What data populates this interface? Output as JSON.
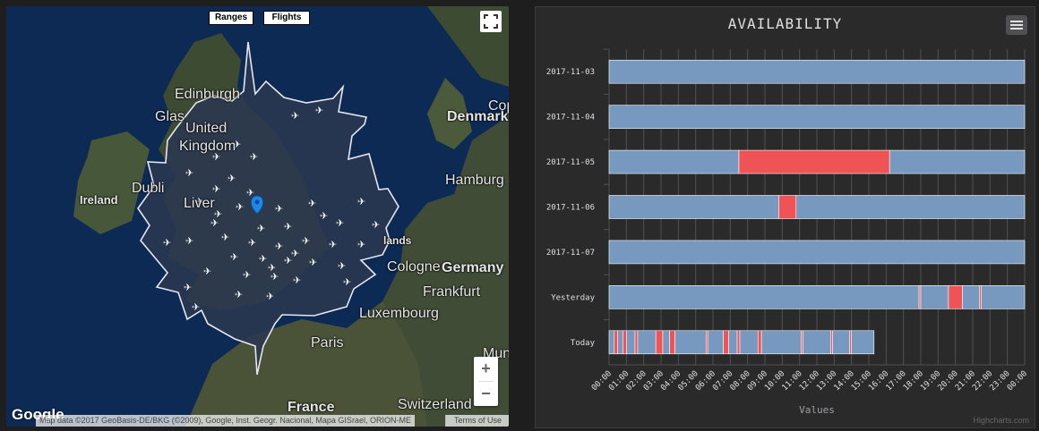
{
  "map": {
    "buttons": {
      "ranges": "Ranges",
      "flights": "Flights"
    },
    "labels": [
      {
        "name": "label-edinburgh",
        "text": "Edinburgh",
        "size": 11
      },
      {
        "name": "label-glasgow",
        "text": "Glas",
        "size": 11
      },
      {
        "name": "label-united",
        "text": "United",
        "size": 16
      },
      {
        "name": "label-kingdom",
        "text": "Kingdom",
        "size": 16
      },
      {
        "name": "label-denmark",
        "text": "Denmark",
        "size": 11
      },
      {
        "name": "label-cop",
        "text": "Cop",
        "size": 11
      },
      {
        "name": "label-ireland",
        "text": "Ireland",
        "size": 13
      },
      {
        "name": "label-dublin",
        "text": "Dubli",
        "size": 11
      },
      {
        "name": "label-hamburg",
        "text": "Hamburg",
        "size": 11
      },
      {
        "name": "label-liverpool",
        "text": "Liver",
        "size": 11
      },
      {
        "name": "label-lands",
        "text": "lands",
        "size": 12
      },
      {
        "name": "label-germany",
        "text": "Germany",
        "size": 16
      },
      {
        "name": "label-cologne",
        "text": "Cologne",
        "size": 11
      },
      {
        "name": "label-frankfurt",
        "text": "Frankfurt",
        "size": 11
      },
      {
        "name": "label-luxembourg",
        "text": "Luxembourg",
        "size": 11
      },
      {
        "name": "label-paris",
        "text": "Paris",
        "size": 11
      },
      {
        "name": "label-munic",
        "text": "Munic",
        "size": 11
      },
      {
        "name": "label-france",
        "text": "France",
        "size": 16
      },
      {
        "name": "label-switzerland",
        "text": "Switzerland",
        "size": 11
      }
    ],
    "google": "Google",
    "attribution": "Map data ©2017 GeoBasis-DE/BKG (©2009), Google, Inst. Geogr. Nacional, Mapa GISrael, ORION-ME",
    "terms": "Terms of Use",
    "zoom_in": "+",
    "zoom_out": "−",
    "colors": {
      "sea": "#0d2a55",
      "land": "#3d4a33",
      "range_fill": "#2c3a52",
      "range_stroke": "#e8e8f0",
      "marker": "#1e88e5"
    }
  },
  "chart": {
    "title": "AVAILABILITY",
    "xlabel": "Values",
    "credits": "Highcharts.com",
    "colors": {
      "available": "#7798bf",
      "unavailable": "#f05356",
      "bg": "#2a2a2b",
      "grid": "#505053",
      "text": "#e0e0e3"
    }
  },
  "chart_data": {
    "type": "bar",
    "title": "AVAILABILITY",
    "xlabel": "Values",
    "categories": [
      "2017-11-03",
      "2017-11-04",
      "2017-11-05",
      "2017-11-06",
      "2017-11-07",
      "Yesterday",
      "Today"
    ],
    "x_ticks": [
      "00:00",
      "01:00",
      "02:00",
      "03:00",
      "04:00",
      "05:00",
      "06:00",
      "07:00",
      "08:00",
      "09:00",
      "10:00",
      "11:00",
      "12:00",
      "13:00",
      "14:00",
      "15:00",
      "16:00",
      "17:00",
      "18:00",
      "19:00",
      "20:00",
      "21:00",
      "22:00",
      "23:00",
      "00:00"
    ],
    "xlim_hours": [
      0,
      24
    ],
    "legend": "none",
    "grid": true,
    "series": [
      {
        "category": "2017-11-03",
        "segments": [
          {
            "start": 0,
            "end": 24,
            "status": "available"
          }
        ]
      },
      {
        "category": "2017-11-04",
        "segments": [
          {
            "start": 0,
            "end": 24,
            "status": "available"
          }
        ]
      },
      {
        "category": "2017-11-05",
        "segments": [
          {
            "start": 0,
            "end": 7.5,
            "status": "available"
          },
          {
            "start": 7.5,
            "end": 16.2,
            "status": "unavailable"
          },
          {
            "start": 16.2,
            "end": 24,
            "status": "available"
          }
        ]
      },
      {
        "category": "2017-11-06",
        "segments": [
          {
            "start": 0,
            "end": 9.8,
            "status": "available"
          },
          {
            "start": 9.8,
            "end": 10.8,
            "status": "unavailable"
          },
          {
            "start": 10.8,
            "end": 24,
            "status": "available"
          }
        ]
      },
      {
        "category": "2017-11-07",
        "segments": [
          {
            "start": 0,
            "end": 24,
            "status": "available"
          }
        ]
      },
      {
        "category": "Yesterday",
        "segments": [
          {
            "start": 0,
            "end": 17.9,
            "status": "available"
          },
          {
            "start": 17.9,
            "end": 18.0,
            "status": "unavailable"
          },
          {
            "start": 18.0,
            "end": 19.6,
            "status": "available"
          },
          {
            "start": 19.6,
            "end": 20.4,
            "status": "unavailable"
          },
          {
            "start": 20.4,
            "end": 21.4,
            "status": "available"
          },
          {
            "start": 21.4,
            "end": 21.5,
            "status": "unavailable"
          },
          {
            "start": 21.5,
            "end": 24,
            "status": "available"
          }
        ]
      },
      {
        "category": "Today",
        "segments": [
          {
            "start": 0,
            "end": 0.3,
            "status": "available"
          },
          {
            "start": 0.3,
            "end": 0.5,
            "status": "unavailable"
          },
          {
            "start": 0.5,
            "end": 0.8,
            "status": "available"
          },
          {
            "start": 0.8,
            "end": 1.0,
            "status": "unavailable"
          },
          {
            "start": 1.0,
            "end": 1.5,
            "status": "available"
          },
          {
            "start": 1.5,
            "end": 1.65,
            "status": "unavailable"
          },
          {
            "start": 1.65,
            "end": 2.7,
            "status": "available"
          },
          {
            "start": 2.7,
            "end": 3.1,
            "status": "unavailable"
          },
          {
            "start": 3.1,
            "end": 3.5,
            "status": "available"
          },
          {
            "start": 3.5,
            "end": 3.8,
            "status": "unavailable"
          },
          {
            "start": 3.8,
            "end": 5.6,
            "status": "available"
          },
          {
            "start": 5.6,
            "end": 5.7,
            "status": "unavailable"
          },
          {
            "start": 5.7,
            "end": 6.6,
            "status": "available"
          },
          {
            "start": 6.6,
            "end": 6.9,
            "status": "unavailable"
          },
          {
            "start": 6.9,
            "end": 7.4,
            "status": "available"
          },
          {
            "start": 7.4,
            "end": 7.55,
            "status": "unavailable"
          },
          {
            "start": 7.55,
            "end": 8.6,
            "status": "available"
          },
          {
            "start": 8.6,
            "end": 8.8,
            "status": "unavailable"
          },
          {
            "start": 8.8,
            "end": 11.1,
            "status": "available"
          },
          {
            "start": 11.1,
            "end": 11.2,
            "status": "unavailable"
          },
          {
            "start": 11.2,
            "end": 12.8,
            "status": "available"
          },
          {
            "start": 12.8,
            "end": 12.9,
            "status": "unavailable"
          },
          {
            "start": 12.9,
            "end": 13.9,
            "status": "available"
          },
          {
            "start": 13.9,
            "end": 14.0,
            "status": "unavailable"
          },
          {
            "start": 14.0,
            "end": 15.3,
            "status": "available"
          }
        ]
      }
    ]
  }
}
